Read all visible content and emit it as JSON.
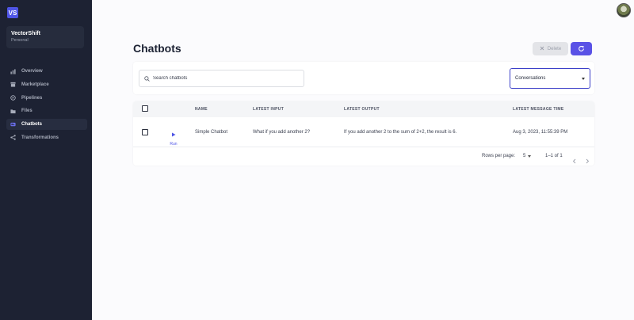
{
  "sidebar": {
    "logo": "VS",
    "workspace": {
      "name": "VectorShift",
      "type": "Personal"
    },
    "items": [
      {
        "label": "Overview",
        "icon": "bar-chart-icon",
        "active": false
      },
      {
        "label": "Marketplace",
        "icon": "store-icon",
        "active": false
      },
      {
        "label": "Pipelines",
        "icon": "pipeline-icon",
        "active": false
      },
      {
        "label": "Files",
        "icon": "folder-icon",
        "active": false
      },
      {
        "label": "Chatbots",
        "icon": "chat-icon",
        "active": true
      },
      {
        "label": "Transformations",
        "icon": "transform-icon",
        "active": false
      }
    ]
  },
  "header": {
    "title": "Chatbots",
    "delete_label": "Delete",
    "refresh_icon": "refresh-icon"
  },
  "search": {
    "placeholder": "Search chatbots",
    "value": ""
  },
  "filter": {
    "selected": "Conversations"
  },
  "table": {
    "columns": [
      "NAME",
      "LATEST INPUT",
      "LATEST OUTPUT",
      "LATEST MESSAGE TIME"
    ],
    "rows": [
      {
        "run_label": "Run",
        "name": "Simple Chatbot",
        "latest_input": "What if you add another 2?",
        "latest_output": "If you add another 2 to the sum of 2+2, the result is 6.",
        "latest_message_time": "Aug 3, 2023, 11:55:39 PM"
      }
    ],
    "pagination": {
      "rows_per_page_label": "Rows per page:",
      "rows_per_page": "5",
      "range": "1–1 of 1"
    }
  },
  "colors": {
    "sidebar_bg": "#1d2233",
    "accent": "#5a52e6"
  }
}
